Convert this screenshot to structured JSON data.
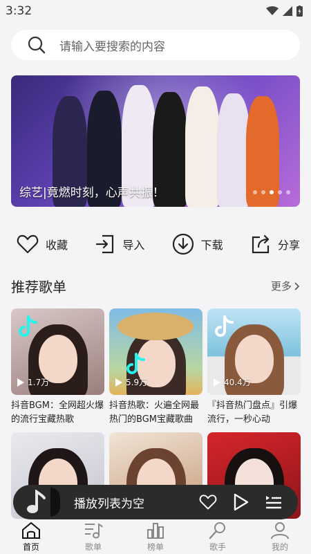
{
  "status": {
    "time": "3:32"
  },
  "search": {
    "placeholder": "请输入要搜索的内容"
  },
  "banner": {
    "caption": "综艺|竟燃时刻，心声共振！",
    "dot_count": 5,
    "active_dot": 3
  },
  "actions": [
    {
      "label": "收藏",
      "icon": "heart-icon"
    },
    {
      "label": "导入",
      "icon": "import-icon"
    },
    {
      "label": "下载",
      "icon": "download-icon"
    },
    {
      "label": "分享",
      "icon": "share-icon"
    }
  ],
  "section": {
    "title": "推荐歌单",
    "more": "更多"
  },
  "playlists": [
    {
      "title": "抖音BGM：全网超火爆的流行宝藏热歌",
      "plays": "1.7万"
    },
    {
      "title": "抖音热歌：火遍全网最热门的BGM宝藏歌曲",
      "plays": "5.9万"
    },
    {
      "title": "『抖音热门盘点』引爆流行，一秒心动",
      "plays": "40.4万"
    },
    {
      "title": "",
      "plays": ""
    },
    {
      "title": "",
      "plays": ""
    },
    {
      "title": "",
      "plays": ""
    }
  ],
  "player": {
    "text": "播放列表为空"
  },
  "tabs": [
    {
      "label": "首页",
      "icon": "home-icon"
    },
    {
      "label": "歌单",
      "icon": "playlist-icon"
    },
    {
      "label": "榜单",
      "icon": "chart-icon"
    },
    {
      "label": "歌手",
      "icon": "singer-icon"
    },
    {
      "label": "我的",
      "icon": "profile-icon"
    }
  ],
  "colors": {
    "accent": "#222222",
    "player_bg": "#2b2b2b",
    "background": "#f4f4f6"
  }
}
